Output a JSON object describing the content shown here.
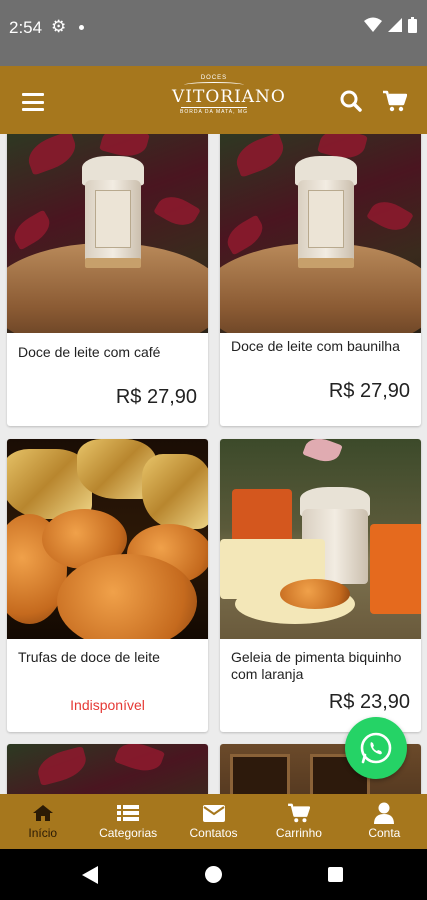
{
  "status_bar": {
    "time": "2:54"
  },
  "header": {
    "logo_top": "DOCES",
    "logo_name": "VITORIANO",
    "logo_sub": "BORDA DA MATA, MG"
  },
  "products": [
    {
      "name": "Doce de leite com café",
      "price": "R$  27,90"
    },
    {
      "name": "Doce de leite com baunilha",
      "price": "R$  27,90"
    },
    {
      "name": "Trufas de doce de leite",
      "status": "Indisponível"
    },
    {
      "name": "Geleia de pimenta biquinho com laranja",
      "price": "R$  23,90"
    }
  ],
  "bottom_nav": {
    "items": [
      {
        "label": "Início",
        "icon": "home-icon"
      },
      {
        "label": "Categorias",
        "icon": "list-icon"
      },
      {
        "label": "Contatos",
        "icon": "envelope-icon"
      },
      {
        "label": "Carrinho",
        "icon": "cart-icon"
      },
      {
        "label": "Conta",
        "icon": "user-icon"
      }
    ]
  },
  "colors": {
    "brand": "#a6771d",
    "status_bar": "#6f6f6f",
    "whatsapp": "#25d366",
    "unavailable": "#e53935"
  }
}
